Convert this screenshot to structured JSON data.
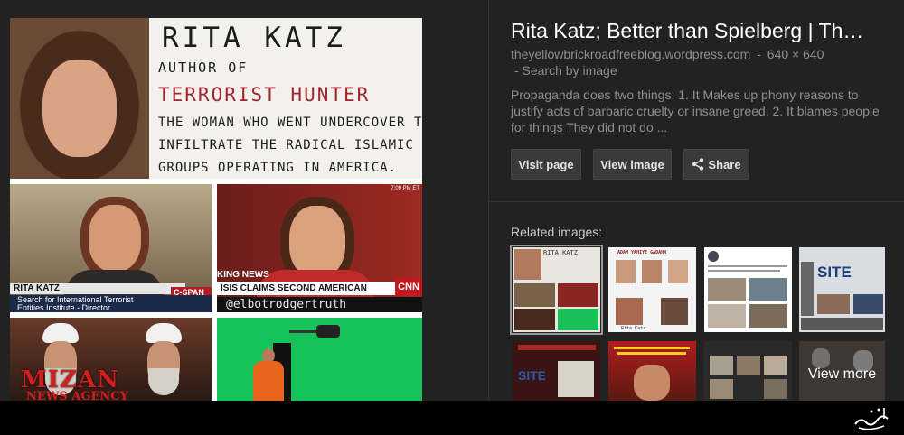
{
  "collage": {
    "name": "RITA KATZ",
    "author_of": "AUTHOR OF",
    "book": "TERRORIST HUNTER",
    "desc_lines": [
      "THE WOMAN WHO WENT UNDERCOVER TO",
      "INFILTRATE THE RADICAL ISLAMIC",
      "GROUPS OPERATING IN AMERICA."
    ],
    "cap1_name": "RITA KATZ",
    "cap1_network": "C-SPAN 2",
    "cap1_sub_lines": [
      "Search for International Terrorist",
      "Entities Institute - Director"
    ],
    "cap2_knews": "KING NEWS",
    "cap2_headline": "ISIS CLAIMS SECOND AMERICAN BEHEADED",
    "cap2_network": "CNN",
    "cap2_handle": "@elbotrodgertruth",
    "cap2_time": "7:09 PM ET",
    "logo_main": "MIZAN",
    "logo_sub": "NEWS AGENCY"
  },
  "detail": {
    "title": "Rita Katz; Better than Spielberg | Th…",
    "source_domain": "theyellowbrickroadfreeblog.wordpress.com",
    "separator": "-",
    "dimensions": "640 × 640",
    "search_by_image": "- Search by image",
    "description_lines": [
      "Propaganda does two things: 1. It Makes up phony reasons to",
      "justify acts of barbaric cruelty or insane greed. 2. It blames people",
      "for things They did not do ..."
    ]
  },
  "buttons": {
    "visit": "Visit page",
    "view": "View image",
    "share": "Share"
  },
  "related": {
    "label": "Related images:",
    "view_more": "View more",
    "thumb_texts": {
      "t1": "RITA KATZ",
      "t2": "ADAM YAHIYE GADAHN",
      "t2_caption": "Rita Katz",
      "t4_logo": "SITE",
      "t5_logo": "SITE"
    }
  },
  "colors": {
    "background": "#222222",
    "title": "#ffffff",
    "muted_text": "#8e8e8e",
    "button": "#3a3a3a",
    "accent_red": "#a3262e"
  },
  "icons": {
    "share": "share-icon",
    "watermark": "arabic-calligraphy-logo"
  }
}
